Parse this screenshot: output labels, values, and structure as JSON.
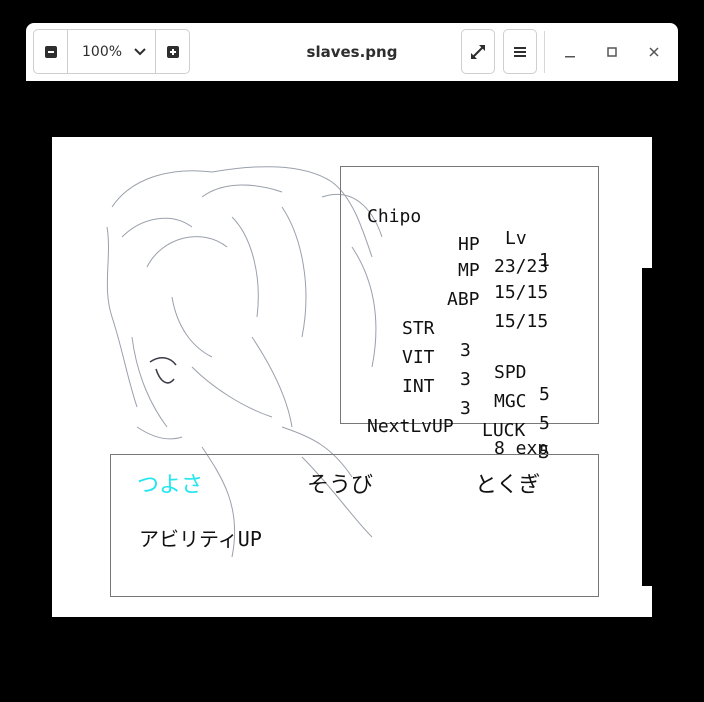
{
  "toolbar": {
    "zoom_out_icon": "zoom-out-icon",
    "zoom_value": "100%",
    "zoom_in_icon": "zoom-in-icon",
    "title": "slaves.png"
  },
  "game": {
    "character_name": "Chipo",
    "level_label": "Lv",
    "level_value": "1",
    "hp": {
      "label": "HP",
      "value": "23/23"
    },
    "mp": {
      "label": "MP",
      "value": "15/15"
    },
    "abp": {
      "label": "ABP",
      "value": "15/15"
    },
    "str": {
      "label": "STR",
      "value": "3"
    },
    "spd": {
      "label": "SPD",
      "value": "5"
    },
    "vit": {
      "label": "VIT",
      "value": "3"
    },
    "mgc": {
      "label": "MGC",
      "value": "5"
    },
    "int": {
      "label": "INT",
      "value": "3"
    },
    "luck": {
      "label": "LUCK",
      "value": "5"
    },
    "next_level_label": "NextLvUP",
    "next_level_value": "8 exp",
    "tabs": [
      {
        "label": "つよさ",
        "active": true
      },
      {
        "label": "そうび",
        "active": false
      },
      {
        "label": "とくぎ",
        "active": false
      }
    ],
    "ability_label": "アビリティUP",
    "active_color": "#22e6f0"
  }
}
